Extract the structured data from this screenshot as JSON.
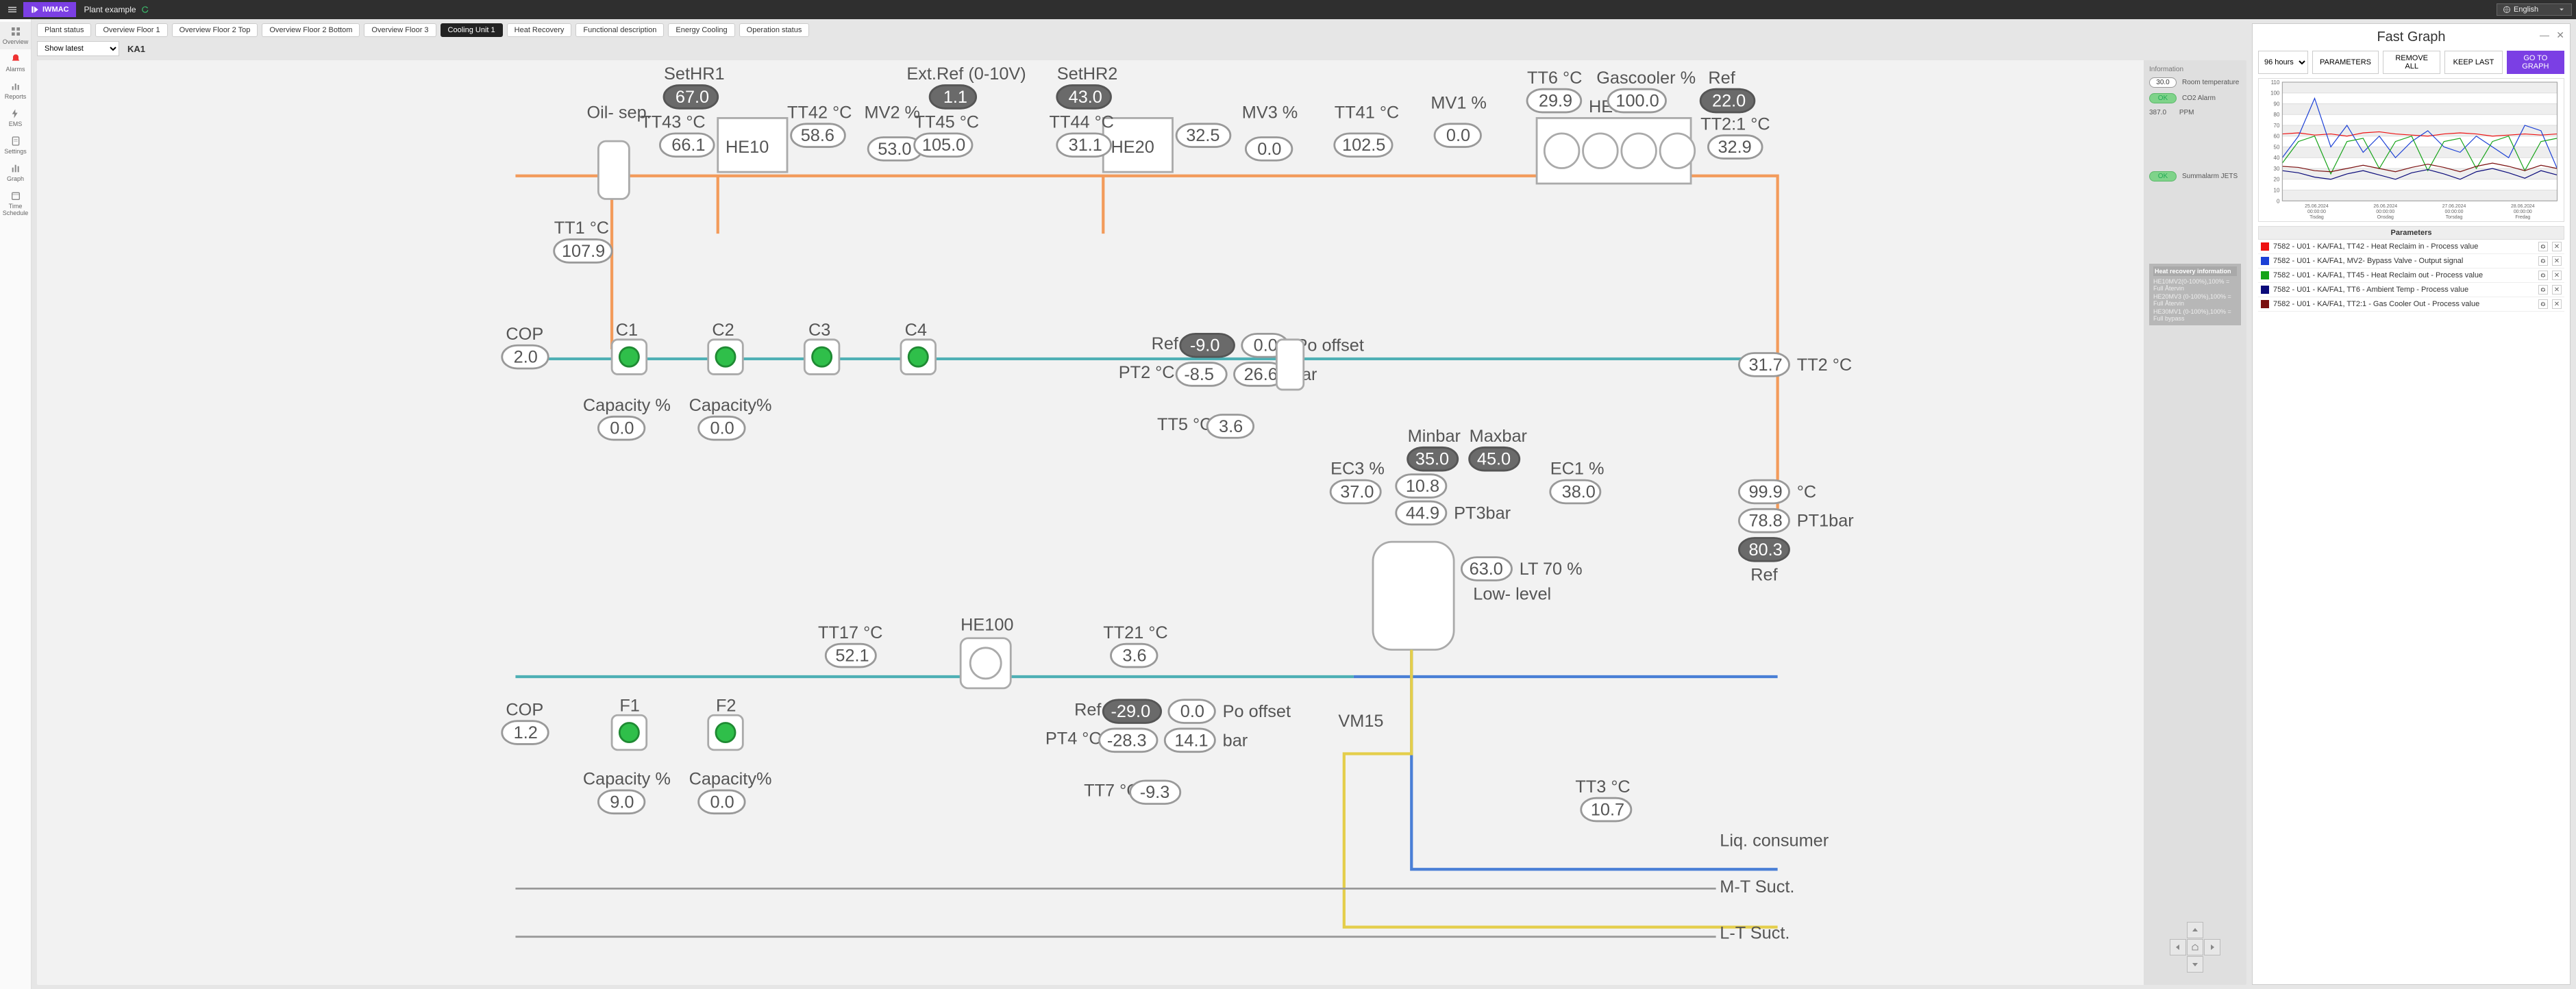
{
  "header": {
    "brand": "IWMAC",
    "plant": "Plant example",
    "language": "English"
  },
  "leftnav": {
    "overview": "Overview",
    "alarms": "Alarms",
    "reports": "Reports",
    "ems": "EMS",
    "settings": "Settings",
    "graph": "Graph",
    "schedule": "Time Schedule"
  },
  "tabs": [
    "Plant status",
    "Overview Floor 1",
    "Overview Floor 2 Top",
    "Overview Floor 2 Bottom",
    "Overview Floor 3",
    "Cooling Unit 1",
    "Heat Recovery",
    "Functional description",
    "Energy Cooling",
    "Operation status"
  ],
  "active_tab": "Cooling Unit 1",
  "toolbar": {
    "show_latest": "Show latest",
    "unit": "KA1"
  },
  "info": {
    "title": "Information",
    "room_temp_label": "Room temperature",
    "room_temp": "30.0",
    "co2_label": "CO2 Alarm",
    "co2_status": "OK",
    "ppm_label": "PPM",
    "ppm": "387.0",
    "jets_label": "Summalarm JETS",
    "jets_status": "OK"
  },
  "hr_info": {
    "title": "Heat recovery information",
    "lines": [
      "HE10MV2(0-100%),100% = Full Återvin",
      "HE20MV3 (0-100%),100% = Full Återvin",
      "HE30MV1 (0-100%),100% = Full bypass"
    ]
  },
  "diagram": {
    "oil_sep": "Oil- sep.",
    "sethr1": "SetHR1",
    "sethr1_v": "67.0",
    "tt43": "TT43 °C",
    "tt43_v": "66.1",
    "he10": "HE10",
    "tt42": "TT42 °C",
    "tt42_v": "58.6",
    "mv2": "MV2 %",
    "mv2_v": "53.0",
    "extref": "Ext.Ref (0-10V)",
    "extref_v": "1.1",
    "tt45": "TT45 °C",
    "tt45_v": "105.0",
    "sethr2": "SetHR2",
    "sethr2_v": "43.0",
    "he20": "HE20",
    "tt44": "TT44 °C",
    "tt44_v": "31.1",
    "tt44b_v": "32.5",
    "mv3": "MV3 %",
    "mv3_v": "0.0",
    "tt41": "TT41 °C",
    "tt41_v": "102.5",
    "mv1": "MV1 %",
    "mv1_v": "0.0",
    "tt6": "TT6 °C",
    "tt6_v": "29.9",
    "gascooler": "Gascooler %",
    "gascooler_v": "100.0",
    "he30": "HE30",
    "ref1": "Ref",
    "ref1_v": "22.0",
    "tt21r": "TT2:1 °C",
    "tt21r_v": "32.9",
    "tt1": "TT1 °C",
    "tt1_v": "107.9",
    "c1": "C1",
    "c2": "C2",
    "c3": "C3",
    "c4": "C4",
    "cop": "COP",
    "cop_v": "2.0",
    "cap": "Capacity %",
    "cap_v": "0.0",
    "cappc": "Capacity%",
    "cappc_v": "0.0",
    "ref2": "Ref",
    "ref2_v": "-9.0",
    "ref2b": "0.0",
    "po_off": "Po offset",
    "pt2": "PT2 °C",
    "pt2_v": "-8.5",
    "pt2b": "26.6",
    "bar": "bar",
    "tt5": "TT5 °C",
    "tt5_v": "3.6",
    "minbar": "Minbar",
    "minbar_v": "35.0",
    "maxbar": "Maxbar",
    "maxbar_v": "45.0",
    "ec3": "EC3 %",
    "ec3_v": "37.0",
    "p108": "10.8",
    "pt3": "PT3bar",
    "pt3_v": "44.9",
    "ec1": "EC1 %",
    "ec1_v": "38.0",
    "tt2": "TT2 °C",
    "tt2_v": "31.7",
    "degC": "°C",
    "pt1bar": "PT1bar",
    "pt1_a": "99.9",
    "pt1_b": "78.8",
    "p803": "80.3",
    "reflbl": "Ref",
    "lt70": "LT 70 %",
    "lt70_v": "63.0",
    "low": "Low- level",
    "tt17": "TT17 °C",
    "tt17_v": "52.1",
    "he100": "HE100",
    "tt21": "TT21 °C",
    "tt21_v": "3.6",
    "f1": "F1",
    "f2": "F2",
    "cop2": "COP",
    "cop2_v": "1.2",
    "cap2": "Capacity %",
    "cap2_v": "9.0",
    "cappc2": "Capacity%",
    "cappc2_v": "0.0",
    "ref3": "Ref",
    "ref3_v": "-29.0",
    "ref3b": "0.0",
    "po_off2": "Po offset",
    "pt4": "PT4 °C",
    "pt4_v": "-28.3",
    "pt4b": "14.1",
    "tt7": "TT7 °C",
    "tt7_v": "-9.3",
    "vm15": "VM15",
    "tt3": "TT3 °C",
    "tt3_v": "10.7",
    "liq": "Liq. consumer",
    "mt": "M-T Suct.",
    "lt": "L-T Suct."
  },
  "fast_graph": {
    "title": "Fast Graph",
    "range": "96 hours",
    "btn_params": "PARAMETERS",
    "btn_remove": "REMOVE ALL",
    "btn_keep": "KEEP LAST",
    "btn_go": "GO TO GRAPH",
    "param_header": "Parameters",
    "series": [
      {
        "color": "#e11",
        "label": "7582 - U01 - KA/FA1, TT42 - Heat Reclaim in - Process value"
      },
      {
        "color": "#1c40d6",
        "label": "7582 - U01 - KA/FA1, MV2- Bypass Valve - Output signal"
      },
      {
        "color": "#16a318",
        "label": "7582 - U01 - KA/FA1, TT45 - Heat Reclaim out - Process value"
      },
      {
        "color": "#0a0a7a",
        "label": "7582 - U01 - KA/FA1, TT6 - Ambient Temp - Process value"
      },
      {
        "color": "#7a0f0f",
        "label": "7582 - U01 - KA/FA1, TT2:1 - Gas Cooler Out - Process value"
      }
    ]
  },
  "chart_data": {
    "type": "line",
    "ylim": [
      0,
      110
    ],
    "yticks": [
      0,
      10,
      20,
      30,
      40,
      50,
      60,
      70,
      80,
      90,
      100,
      110
    ],
    "x_labels": [
      {
        "date": "25.06.2024",
        "time": "00:00:00",
        "day": "Tisdag"
      },
      {
        "date": "26.06.2024",
        "time": "00:00:00",
        "day": "Onsdag"
      },
      {
        "date": "27.06.2024",
        "time": "00:00:00",
        "day": "Torsdag"
      },
      {
        "date": "28.06.2024",
        "time": "00:00:00",
        "day": "Fredag"
      }
    ],
    "series": [
      {
        "name": "TT42 Heat Reclaim in",
        "color": "#e11",
        "values": [
          62,
          63,
          61,
          62,
          60,
          63,
          64,
          62,
          61,
          60,
          62,
          63,
          62,
          60,
          61,
          62,
          61,
          62
        ]
      },
      {
        "name": "MV2 Bypass Valve",
        "color": "#1c40d6",
        "values": [
          40,
          60,
          95,
          50,
          70,
          45,
          60,
          40,
          55,
          65,
          50,
          45,
          60,
          50,
          40,
          70,
          65,
          30
        ]
      },
      {
        "name": "TT45 Heat Reclaim out",
        "color": "#16a318",
        "values": [
          35,
          55,
          60,
          25,
          55,
          58,
          30,
          55,
          60,
          28,
          55,
          58,
          30,
          55,
          60,
          28,
          55,
          58
        ]
      },
      {
        "name": "TT6 Ambient Temp",
        "color": "#0a0a7a",
        "values": [
          28,
          26,
          22,
          20,
          25,
          28,
          24,
          20,
          26,
          29,
          25,
          20,
          27,
          30,
          26,
          21,
          28,
          24
        ]
      },
      {
        "name": "TT2:1 Gas Cooler Out",
        "color": "#7a0f0f",
        "values": [
          32,
          31,
          28,
          27,
          30,
          33,
          30,
          27,
          31,
          34,
          31,
          27,
          32,
          35,
          32,
          28,
          33,
          30
        ]
      }
    ]
  }
}
